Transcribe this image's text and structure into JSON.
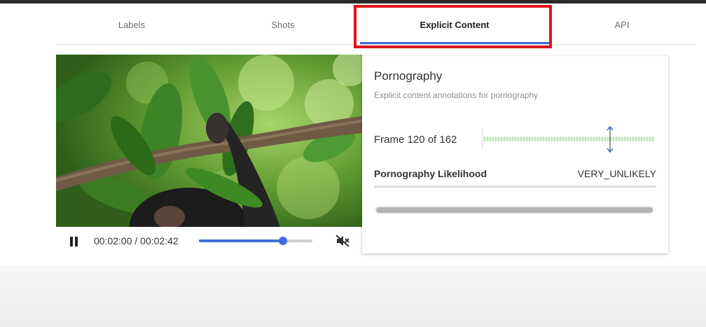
{
  "tabs": [
    {
      "label": "Labels"
    },
    {
      "label": "Shots"
    },
    {
      "label": "Explicit Content"
    },
    {
      "label": "API"
    }
  ],
  "active_tab": "Explicit Content",
  "player": {
    "time": "00:02:00 / 00:02:42",
    "progress": 0.74,
    "state": "playing",
    "muted": true
  },
  "card": {
    "title": "Pornography",
    "subtitle": "Explicit content annotations for pornography",
    "frame": "Frame 120 of 162",
    "likelihood_label": "Pornography Likelihood",
    "likelihood_value": "VERY_UNLIKELY"
  },
  "colors": {
    "accent": "#3c6fd8",
    "highlight": "#e0131a",
    "timeline_tick": "#bfe3b8"
  }
}
